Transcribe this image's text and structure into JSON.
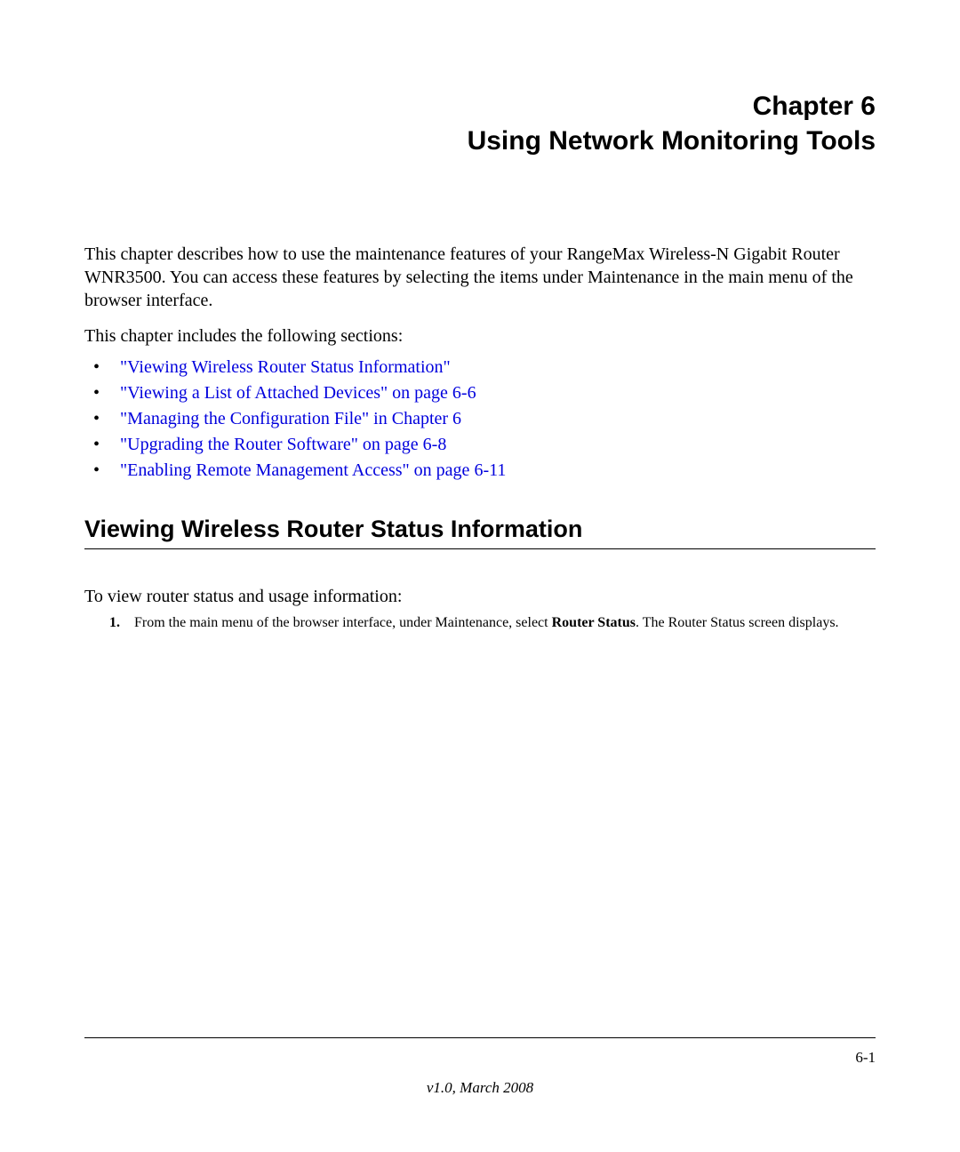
{
  "header": {
    "chapter_line": "Chapter 6",
    "title_line": "Using Network Monitoring Tools"
  },
  "intro": "This chapter describes how to use the maintenance features of your RangeMax Wireless-N Gigabit Router WNR3500. You can access these features by selecting the items under Maintenance in the main menu of the browser interface.",
  "sections_intro": "This chapter includes the following sections:",
  "toc": [
    "\"Viewing Wireless Router Status Information\"",
    "\"Viewing a List of Attached Devices\" on page 6-6",
    "\"Managing the Configuration File\" in Chapter 6",
    "\"Upgrading the Router Software\" on page 6-8",
    "\"Enabling Remote Management Access\" on page 6-11"
  ],
  "section_heading": "Viewing Wireless Router Status Information",
  "body_lead": "To view router status and usage information:",
  "step1_marker": "1.",
  "step1_pre": "From the main menu of the browser interface, under Maintenance, select ",
  "step1_bold": "Router Status",
  "step1_post": ". The Router Status screen displays.",
  "footer": {
    "page_number": "6-1",
    "version": "v1.0, March 2008"
  }
}
